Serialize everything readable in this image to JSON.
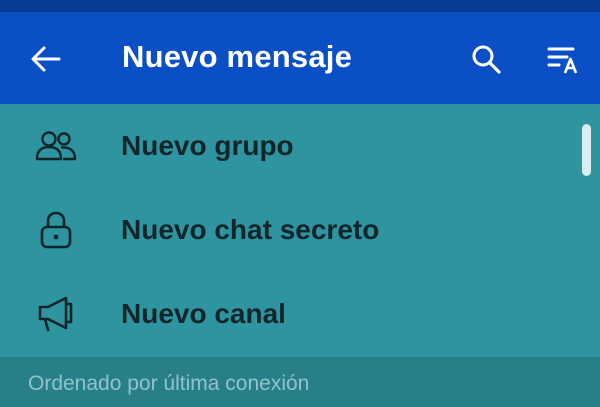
{
  "colors": {
    "status_bar": "#063b96",
    "app_bar": "#0b4fc7",
    "list_background": "#2e949f",
    "section_header_background": "#287f88",
    "section_header_text": "#8ec4c9",
    "item_text": "#10262b"
  },
  "header": {
    "title": "Nuevo mensaje",
    "back_icon": "arrow-left-icon",
    "search_icon": "search-icon",
    "sort_icon": "sort-alphabetical-icon"
  },
  "menu": {
    "items": [
      {
        "label": "Nuevo grupo",
        "icon": "people-icon"
      },
      {
        "label": "Nuevo chat secreto",
        "icon": "lock-icon"
      },
      {
        "label": "Nuevo canal",
        "icon": "megaphone-icon"
      }
    ]
  },
  "contacts": {
    "section_label": "Ordenado por última conexión"
  }
}
